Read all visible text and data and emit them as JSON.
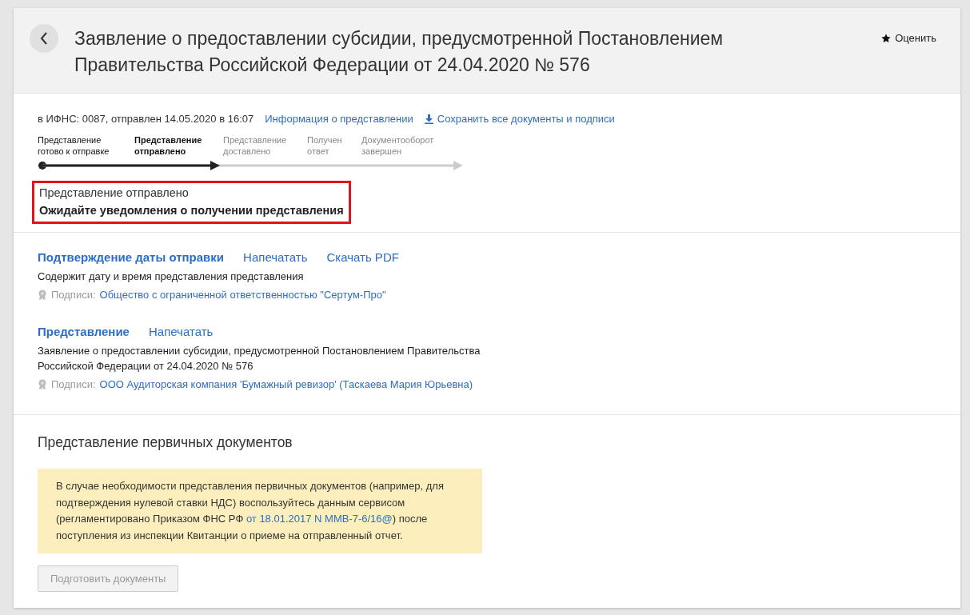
{
  "header": {
    "title": "Заявление о предоставлении субсидии, предусмотренной Постановлением Правительства Российской Федерации от 24.04.2020 № 576",
    "rate_button": "Оценить"
  },
  "meta": {
    "text": "в ИФНС: 0087, отправлен 14.05.2020 в 16:07",
    "info_link": "Информация о представлении",
    "save_link": "Сохранить все документы и подписи"
  },
  "steps": [
    {
      "label": "Представление готово к отправке",
      "completed": true,
      "selected": false
    },
    {
      "label": "Представление отправлено",
      "completed": true,
      "selected": true
    },
    {
      "label": "Представление доставлено",
      "completed": false,
      "selected": false
    },
    {
      "label": "Получен ответ",
      "completed": false,
      "selected": false
    },
    {
      "label": "Документооборот завершен",
      "completed": false,
      "selected": false
    }
  ],
  "status": {
    "highlighted": true,
    "title": "Представление отправлено",
    "message": "Ожидайте уведомления о получении представления"
  },
  "documents": [
    {
      "title": "Подтверждение даты отправки",
      "actions": [
        "Напечатать",
        "Скачать PDF"
      ],
      "description": "Содержит дату и время представления представления",
      "signatures_label": "Подписи:",
      "signer": "Общество с ограниченной ответственностью \"Сертум-Про\""
    },
    {
      "title": "Представление",
      "actions": [
        "Напечатать"
      ],
      "description": "Заявление о предоставлении субсидии, предусмотренной Постановлением Правительства Российской Федерации от 24.04.2020 № 576",
      "signatures_label": "Подписи:",
      "signer": "ООО Аудиторская компания 'Бумажный ревизор' (Таскаева Мария Юрьевна)"
    }
  ],
  "primary_docs": {
    "title": "Представление первичных документов",
    "notice_before": "В случае необходимости представления первичных документов (например, для подтверждения нулевой ставки НДС) воспользуйтесь данным сервисом (регламентировано Приказом ФНС РФ ",
    "notice_link": "от 18.01.2017 N ММВ-7-6/16@",
    "notice_after": ") после поступления из инспекции Квитанции о приеме на отправленный отчет.",
    "button": {
      "label": "Подготовить документы",
      "disabled": true
    }
  }
}
